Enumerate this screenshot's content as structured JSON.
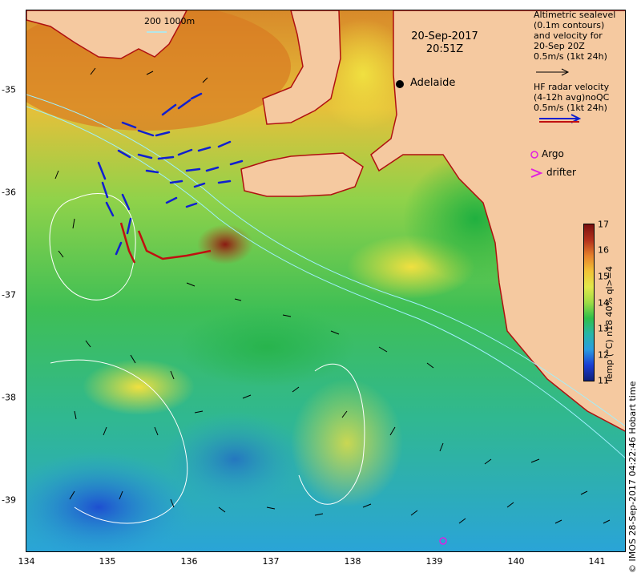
{
  "map": {
    "date_title": [
      "20-Sep-2017",
      "20:51Z"
    ],
    "city": {
      "name": "Adelaide",
      "lon": 138.6,
      "lat": -34.93
    },
    "scale_label": "200  1000m",
    "legend_altimetry": [
      "Altimetric sealevel",
      "(0.1m contours)",
      "and velocity for",
      "20-Sep 20Z",
      "0.5m/s (1kt 24h)"
    ],
    "legend_hf": [
      "HF radar velocity",
      "(4-12h avg)noQC",
      "0.5m/s (1kt 24h)"
    ],
    "argo_label": "Argo",
    "drifter_label": "drifter",
    "colorbar": {
      "min": 11,
      "max": 17,
      "ticks": [
        "17",
        "16",
        "15",
        "14",
        "13",
        "12",
        "11"
      ],
      "title": "Temp (°C) n18 40% ql>=4"
    },
    "credit": "© IMOS 28-Sep-2017 04:22:46 Hobart time",
    "lon_ticks": [
      "134",
      "135",
      "136",
      "137",
      "138",
      "139",
      "140",
      "141"
    ],
    "lat_ticks": [
      "-35",
      "-36",
      "-37",
      "-38",
      "-39"
    ],
    "lon_range": [
      134,
      141.3
    ],
    "lat_range": [
      -39.5,
      -34.2
    ],
    "colors": {
      "land": "#f5c9a0",
      "coast": "#b01010",
      "hf_arrow": "#1020d0",
      "argo": "#e020e0"
    }
  }
}
